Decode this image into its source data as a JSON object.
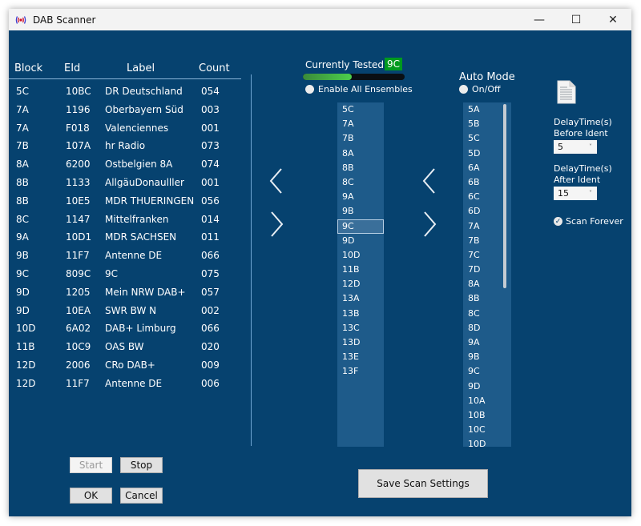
{
  "window": {
    "title": "DAB Scanner",
    "app_icon": "radio-broadcast-icon",
    "controls": {
      "minimize": "—",
      "maximize": "☐",
      "close": "✕"
    }
  },
  "table": {
    "headers": [
      "Block",
      "EId",
      "Label",
      "Count"
    ],
    "rows": [
      [
        "5C",
        "10BC",
        "DR Deutschland",
        "054"
      ],
      [
        "7A",
        "1196",
        "Oberbayern Süd",
        "003"
      ],
      [
        "7A",
        "F018",
        "Valenciennes",
        "001"
      ],
      [
        "7B",
        "107A",
        "hr Radio",
        "073"
      ],
      [
        "8A",
        "6200",
        "Ostbelgien 8A",
        "074"
      ],
      [
        "8B",
        "1133",
        "AllgäuDonaulller",
        "001"
      ],
      [
        "8B",
        "10E5",
        "MDR THUERINGEN",
        "056"
      ],
      [
        "8C",
        "1147",
        "Mittelfranken",
        "014"
      ],
      [
        "9A",
        "10D1",
        "MDR SACHSEN",
        "011"
      ],
      [
        "9B",
        "11F7",
        "Antenne DE",
        "066"
      ],
      [
        "9C",
        "809C",
        "9C",
        "075"
      ],
      [
        "9D",
        "1205",
        "Mein NRW DAB+",
        "057"
      ],
      [
        "9D",
        "10EA",
        "SWR BW N",
        "002"
      ],
      [
        "10D",
        "6A02",
        "DAB+ Limburg",
        "066"
      ],
      [
        "11B",
        "10C9",
        "OAS BW",
        "020"
      ],
      [
        "12D",
        "2006",
        "CRo DAB+",
        "009"
      ],
      [
        "12D",
        "11F7",
        "Antenne DE",
        "006"
      ]
    ]
  },
  "scan": {
    "currently_tested_label": "Currently Tested",
    "currently_tested_value": "9C",
    "progress_percent": 48,
    "enable_all_label": "Enable All Ensembles",
    "enable_all_checked": false
  },
  "ensembles_list": {
    "items": [
      "5C",
      "7A",
      "7B",
      "8A",
      "8B",
      "8C",
      "9A",
      "9B",
      "9C",
      "9D",
      "10D",
      "11B",
      "12D",
      "13A",
      "13B",
      "13C",
      "13D",
      "13E",
      "13F"
    ],
    "selected": "9C"
  },
  "auto_mode": {
    "title": "Auto Mode",
    "toggle_label": "On/Off",
    "checked": false,
    "items": [
      "5A",
      "5B",
      "5C",
      "5D",
      "6A",
      "6B",
      "6C",
      "6D",
      "7A",
      "7B",
      "7C",
      "7D",
      "8A",
      "8B",
      "8C",
      "8D",
      "9A",
      "9B",
      "9C",
      "9D",
      "10A",
      "10B",
      "10C",
      "10D"
    ]
  },
  "settings": {
    "delay_before_label_1": "DelayTime(s)",
    "delay_before_label_2": "Before Ident",
    "delay_before_value": "5",
    "delay_after_label_1": "DelayTime(s)",
    "delay_after_label_2": "After Ident",
    "delay_after_value": "15",
    "scan_forever_label": "Scan Forever",
    "scan_forever_checked": true,
    "chevron": "˅",
    "check_mark": "✓"
  },
  "buttons": {
    "start": "Start",
    "stop": "Stop",
    "ok": "OK",
    "cancel": "Cancel",
    "save_scan_settings": "Save Scan Settings"
  },
  "colors": {
    "window_bg": "#06426f",
    "listbox_bg": "#1e5b8a",
    "badge_green": "#009a1e",
    "progress_green": "#4ccf4c"
  }
}
